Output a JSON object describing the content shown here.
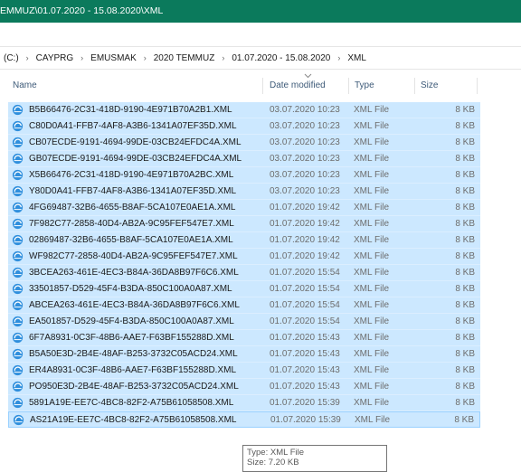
{
  "window": {
    "title": "EMMUZ\\01.07.2020 - 15.08.2020\\XML"
  },
  "address_bar": {
    "crumbs": [
      "(C:)",
      "CAYPRG",
      "EMUSMAK",
      "2020 TEMMUZ",
      "01.07.2020 - 15.08.2020",
      "XML"
    ],
    "separator": "›"
  },
  "columns": {
    "name": "Name",
    "date": "Date modified",
    "type": "Type",
    "size": "Size"
  },
  "files": [
    {
      "name": "B5B66476-2C31-418D-9190-4E971B70A2B1.XML",
      "date": "03.07.2020 10:23",
      "type": "XML File",
      "size": "8 KB"
    },
    {
      "name": "C80D0A41-FFB7-4AF8-A3B6-1341A07EF35D.XML",
      "date": "03.07.2020 10:23",
      "type": "XML File",
      "size": "8 KB"
    },
    {
      "name": "CB07ECDE-9191-4694-99DE-03CB24EFDC4A.XML",
      "date": "03.07.2020 10:23",
      "type": "XML File",
      "size": "8 KB"
    },
    {
      "name": "GB07ECDE-9191-4694-99DE-03CB24EFDC4A.XML",
      "date": "03.07.2020 10:23",
      "type": "XML File",
      "size": "8 KB"
    },
    {
      "name": "X5B66476-2C31-418D-9190-4E971B70A2BC.XML",
      "date": "03.07.2020 10:23",
      "type": "XML File",
      "size": "8 KB"
    },
    {
      "name": "Y80D0A41-FFB7-4AF8-A3B6-1341A07EF35D.XML",
      "date": "03.07.2020 10:23",
      "type": "XML File",
      "size": "8 KB"
    },
    {
      "name": "4FG69487-32B6-4655-B8AF-5CA107E0AE1A.XML",
      "date": "01.07.2020 19:42",
      "type": "XML File",
      "size": "8 KB"
    },
    {
      "name": "7F982C77-2858-40D4-AB2A-9C95FEF547E7.XML",
      "date": "01.07.2020 19:42",
      "type": "XML File",
      "size": "8 KB"
    },
    {
      "name": "02869487-32B6-4655-B8AF-5CA107E0AE1A.XML",
      "date": "01.07.2020 19:42",
      "type": "XML File",
      "size": "8 KB"
    },
    {
      "name": "WF982C77-2858-40D4-AB2A-9C95FEF547E7.XML",
      "date": "01.07.2020 19:42",
      "type": "XML File",
      "size": "8 KB"
    },
    {
      "name": "3BCEA263-461E-4EC3-B84A-36DA8B97F6C6.XML",
      "date": "01.07.2020 15:54",
      "type": "XML File",
      "size": "8 KB"
    },
    {
      "name": "33501857-D529-45F4-B3DA-850C100A0A87.XML",
      "date": "01.07.2020 15:54",
      "type": "XML File",
      "size": "8 KB"
    },
    {
      "name": "ABCEA263-461E-4EC3-B84A-36DA8B97F6C6.XML",
      "date": "01.07.2020 15:54",
      "type": "XML File",
      "size": "8 KB"
    },
    {
      "name": "EA501857-D529-45F4-B3DA-850C100A0A87.XML",
      "date": "01.07.2020 15:54",
      "type": "XML File",
      "size": "8 KB"
    },
    {
      "name": "6F7A8931-0C3F-48B6-AAE7-F63BF155288D.XML",
      "date": "01.07.2020 15:43",
      "type": "XML File",
      "size": "8 KB"
    },
    {
      "name": "B5A50E3D-2B4E-48AF-B253-3732C05ACD24.XML",
      "date": "01.07.2020 15:43",
      "type": "XML File",
      "size": "8 KB"
    },
    {
      "name": "ER4A8931-0C3F-48B6-AAE7-F63BF155288D.XML",
      "date": "01.07.2020 15:43",
      "type": "XML File",
      "size": "8 KB"
    },
    {
      "name": "PO950E3D-2B4E-48AF-B253-3732C05ACD24.XML",
      "date": "01.07.2020 15:43",
      "type": "XML File",
      "size": "8 KB"
    },
    {
      "name": "5891A19E-EE7C-4BC8-82F2-A75B61058508.XML",
      "date": "01.07.2020 15:39",
      "type": "XML File",
      "size": "8 KB"
    },
    {
      "name": "AS21A19E-EE7C-4BC8-82F2-A75B61058508.XML",
      "date": "01.07.2020 15:39",
      "type": "XML File",
      "size": "8 KB"
    }
  ],
  "tooltip": {
    "line1": "Type: XML File",
    "line2": "Size: 7.20 KB"
  },
  "icons": {
    "file": "xml-file-icon",
    "sort": "sort-indicator-icon"
  },
  "colors": {
    "titlebar": "#0b7a5c",
    "selection": "#cce8ff",
    "header_text": "#3d5a78"
  }
}
